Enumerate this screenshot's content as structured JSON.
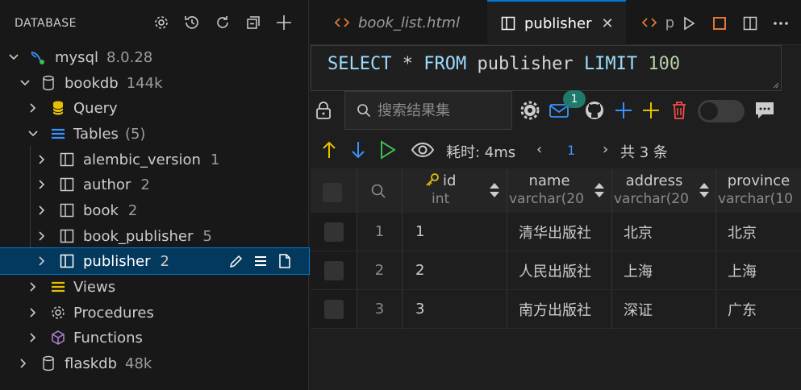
{
  "sidebar": {
    "title": "DATABASE",
    "tree": {
      "connection": {
        "label": "mysql",
        "meta": "8.0.28"
      },
      "db1": {
        "label": "bookdb",
        "meta": "144k"
      },
      "query": {
        "label": "Query"
      },
      "tables": {
        "label": "Tables",
        "meta": "(5)"
      },
      "table_items": [
        {
          "label": "alembic_version",
          "count": "1"
        },
        {
          "label": "author",
          "count": "2"
        },
        {
          "label": "book",
          "count": "2"
        },
        {
          "label": "book_publisher",
          "count": "5"
        },
        {
          "label": "publisher",
          "count": "2"
        }
      ],
      "views": {
        "label": "Views"
      },
      "procedures": {
        "label": "Procedures"
      },
      "functions": {
        "label": "Functions"
      },
      "db2": {
        "label": "flaskdb",
        "meta": "48k"
      }
    }
  },
  "tabs": [
    {
      "label": "book_list.html",
      "icon": "code-icon"
    },
    {
      "label": "publisher",
      "icon": "table-icon",
      "active": true
    },
    {
      "label": "p",
      "icon": "code-icon"
    }
  ],
  "editor": {
    "sql": {
      "k1": "SELECT",
      "star": "*",
      "k2": "FROM",
      "tbl": "publisher",
      "k3": "LIMIT",
      "n": "100"
    }
  },
  "toolbar": {
    "search_placeholder": "搜索结果集",
    "notification_count": "1",
    "time_label": "耗时: 4ms",
    "page": "1",
    "total": "共 3 条",
    "prev": "‹",
    "next": "›"
  },
  "grid": {
    "columns": [
      {
        "name": "id",
        "type": "int",
        "key": true
      },
      {
        "name": "name",
        "type": "varchar(20"
      },
      {
        "name": "address",
        "type": "varchar(20"
      },
      {
        "name": "province",
        "type": "varchar(10"
      }
    ],
    "rows": [
      {
        "num": "1",
        "id": "1",
        "name": "清华出版社",
        "address": "北京",
        "province": "北京"
      },
      {
        "num": "2",
        "id": "2",
        "name": "人民出版社",
        "address": "上海",
        "province": "上海"
      },
      {
        "num": "3",
        "id": "3",
        "name": "南方出版社",
        "address": "深证",
        "province": "广东"
      }
    ]
  },
  "colors": {
    "accent": "#0078d4",
    "link": "#3794ff",
    "add": "#3794ff",
    "plus_yellow": "#e5c000",
    "delete": "#f14c4c",
    "run": "#3fb950"
  }
}
